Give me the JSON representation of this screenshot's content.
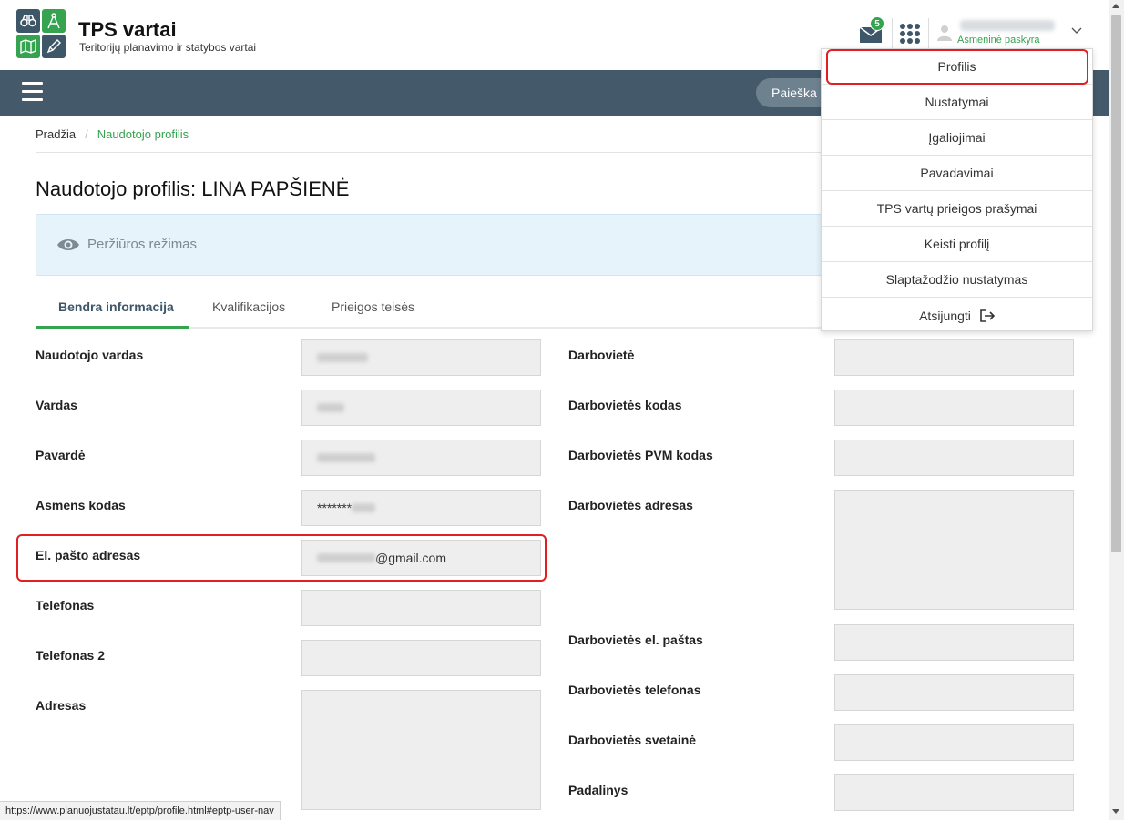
{
  "header": {
    "brand_title": "TPS vartai",
    "brand_subtitle": "Teritorijų planavimo ir statybos vartai",
    "mail_count": "5",
    "account_type": "Asmeninė paskyra"
  },
  "navbar": {
    "search_label": "Paieška"
  },
  "breadcrumb": {
    "home": "Pradžia",
    "current": "Naudotojo profilis"
  },
  "page": {
    "title": "Naudotojo profilis: LINA PAPŠIENĖ",
    "view_mode": "Peržiūros režimas"
  },
  "tabs": [
    {
      "label": "Bendra informacija"
    },
    {
      "label": "Kvalifikacijos"
    },
    {
      "label": "Prieigos teisės"
    }
  ],
  "left_fields": [
    {
      "label": "Naudotojo vardas",
      "value": ""
    },
    {
      "label": "Vardas",
      "value": ""
    },
    {
      "label": "Pavardė",
      "value": ""
    },
    {
      "label": "Asmens kodas",
      "value": "*******"
    },
    {
      "label": "El. pašto adresas",
      "value": "@gmail.com"
    },
    {
      "label": "Telefonas",
      "value": ""
    },
    {
      "label": "Telefonas 2",
      "value": ""
    },
    {
      "label": "Adresas",
      "value": ""
    }
  ],
  "right_fields": [
    {
      "label": "Darbovietė",
      "value": ""
    },
    {
      "label": "Darbovietės kodas",
      "value": ""
    },
    {
      "label": "Darbovietės PVM kodas",
      "value": ""
    },
    {
      "label": "Darbovietės adresas",
      "value": ""
    },
    {
      "label": "Darbovietės el. paštas",
      "value": ""
    },
    {
      "label": "Darbovietės telefonas",
      "value": ""
    },
    {
      "label": "Darbovietės svetainė",
      "value": ""
    },
    {
      "label": "Padalinys",
      "value": ""
    }
  ],
  "menu": {
    "items": [
      {
        "label": "Profilis"
      },
      {
        "label": "Nustatymai"
      },
      {
        "label": "Įgaliojimai"
      },
      {
        "label": "Pavadavimai"
      },
      {
        "label": "TPS vartų prieigos prašymai"
      },
      {
        "label": "Keisti profilį"
      },
      {
        "label": "Slaptažodžio nustatymas"
      },
      {
        "label": "Atsijungti"
      }
    ]
  },
  "status_url": "https://www.planuojustatau.lt/eptp/profile.html#eptp-user-nav",
  "colors": {
    "brand_green": "#35a34f",
    "navbar": "#44596a",
    "highlight": "#e02020"
  }
}
